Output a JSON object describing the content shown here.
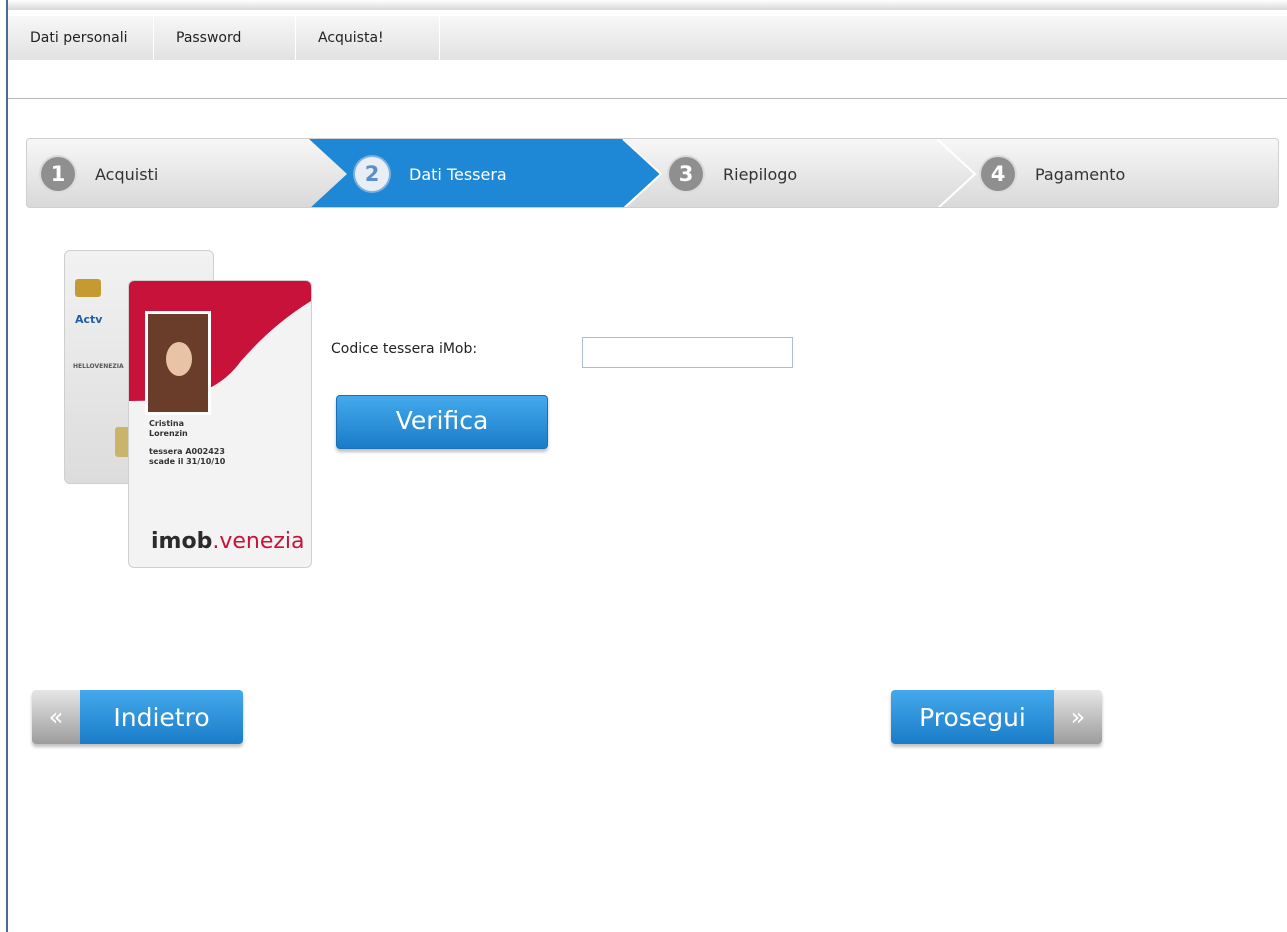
{
  "menu": {
    "tabs": [
      {
        "label": "Dati personali"
      },
      {
        "label": "Password"
      },
      {
        "label": "Acquista!"
      }
    ]
  },
  "wizard": {
    "steps": [
      {
        "number": "1",
        "label": "Acquisti",
        "active": false
      },
      {
        "number": "2",
        "label": "Dati Tessera",
        "active": true
      },
      {
        "number": "3",
        "label": "Riepilogo",
        "active": false
      },
      {
        "number": "4",
        "label": "Pagamento",
        "active": false
      }
    ],
    "active_color": "#1e88d6"
  },
  "card_image": {
    "holder_first": "Cristina",
    "holder_last": "Lorenzin",
    "card_id_line": "tessera  A002423",
    "expiry_line": "scade il  31/10/10",
    "brand": "imob",
    "brand_suffix": ".venezia",
    "back_logo": "Actv",
    "back_logo2": "HELLOVENEZIA"
  },
  "form": {
    "code_label": "Codice tessera iMob:",
    "code_value": "",
    "verify_label": "Verifica"
  },
  "navigation": {
    "back_label": "Indietro",
    "back_icon": "chevron-double-left-icon",
    "next_label": "Prosegui",
    "next_icon": "chevron-double-right-icon"
  }
}
